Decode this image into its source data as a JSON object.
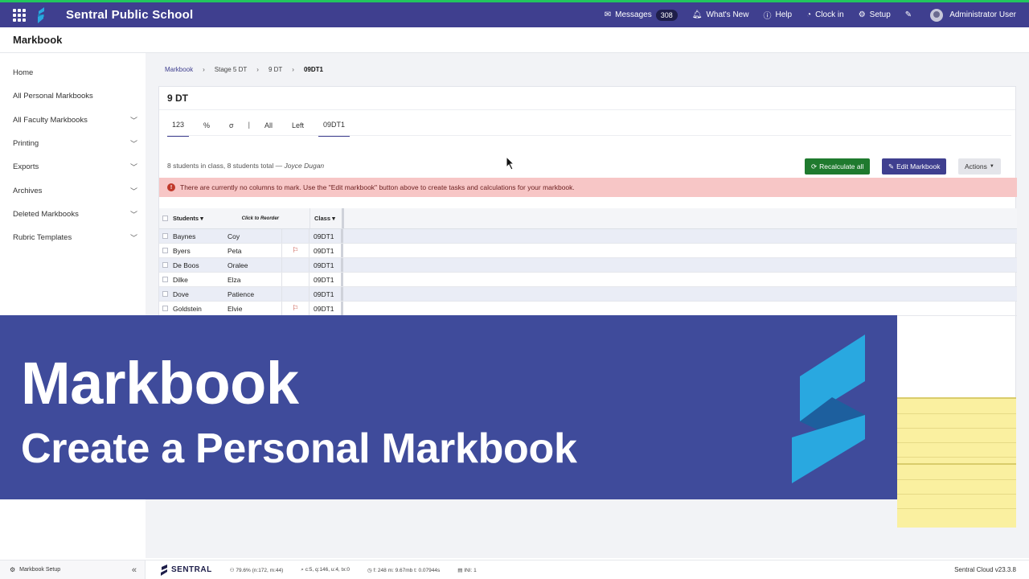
{
  "topbar": {
    "school_name": "Sentral Public School",
    "messages_label": "Messages",
    "messages_count": "308",
    "whats_new": "What's New",
    "help": "Help",
    "clock_in": "Clock in",
    "setup": "Setup",
    "user": "Administrator User",
    "accent_color": "#3f3f8f",
    "top_stripe_color": "#22c55e"
  },
  "page": {
    "title": "Markbook"
  },
  "sidebar": {
    "items": [
      {
        "label": "Home",
        "expandable": false
      },
      {
        "label": "All Personal Markbooks",
        "expandable": false
      },
      {
        "label": "All Faculty Markbooks",
        "expandable": true
      },
      {
        "label": "Printing",
        "expandable": true
      },
      {
        "label": "Exports",
        "expandable": true
      },
      {
        "label": "Archives",
        "expandable": true
      },
      {
        "label": "Deleted Markbooks",
        "expandable": true
      },
      {
        "label": "Rubric Templates",
        "expandable": true
      }
    ]
  },
  "breadcrumb": [
    "Markbook",
    "Stage 5 DT",
    "9 DT",
    "09DT1"
  ],
  "card": {
    "title": "9 DT",
    "tabs": [
      "123",
      "%",
      "σ",
      "|",
      "All",
      "Left",
      "09DT1"
    ],
    "class_info": "8 students in class, 8 students total —",
    "teacher": "Joyce Dugan",
    "recalculate_label": "Recalculate all",
    "edit_label": "Edit Markbook",
    "actions_label": "Actions",
    "alert": "There are currently no columns to mark. Use the \"Edit markbook\" button above to create tasks and calculations for your markbook."
  },
  "table": {
    "headers": {
      "students": "Students",
      "reorder": "Click to Reorder",
      "class": "Class"
    },
    "rows": [
      {
        "last": "Baynes",
        "first": "Coy",
        "flag": false,
        "class": "09DT1"
      },
      {
        "last": "Byers",
        "first": "Peta",
        "flag": true,
        "class": "09DT1"
      },
      {
        "last": "De Boos",
        "first": "Oralee",
        "flag": false,
        "class": "09DT1"
      },
      {
        "last": "Dilke",
        "first": "Elza",
        "flag": false,
        "class": "09DT1"
      },
      {
        "last": "Dove",
        "first": "Patience",
        "flag": false,
        "class": "09DT1"
      },
      {
        "last": "Goldstein",
        "first": "Elvie",
        "flag": true,
        "class": "09DT1"
      }
    ]
  },
  "banner": {
    "title": "Markbook",
    "subtitle": "Create a Personal Markbook",
    "background_color": "#3f4b9b"
  },
  "footer": {
    "setup_label": "Markbook Setup",
    "brand": "SENTRAL",
    "stat1": "79.6% (n:172, m:44)",
    "stat2": "c:5, q:146, u:4, tx:0",
    "stat3": "f: 248 m: 9.67mb t: 0.07944s",
    "stat4": "INI: 1",
    "version": "Sentral Cloud v23.3.8"
  }
}
